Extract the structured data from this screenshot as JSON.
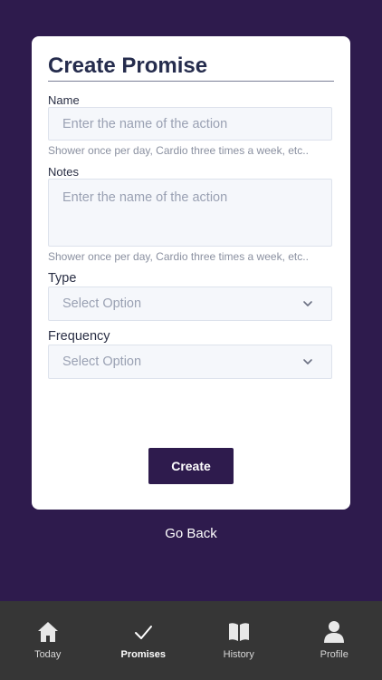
{
  "form": {
    "title": "Create Promise",
    "name_label": "Name",
    "name_placeholder": "Enter the name of the action",
    "name_hint": "Shower once per day, Cardio three times a week, etc..",
    "notes_label": "Notes",
    "notes_placeholder": "Enter the name of the action",
    "notes_hint": "Shower once per day, Cardio three times a week, etc..",
    "type_label": "Type",
    "type_value": "Select Option",
    "frequency_label": "Frequency",
    "frequency_value": "Select Option",
    "create_label": "Create"
  },
  "go_back_label": "Go Back",
  "tabs": [
    {
      "label": "Today",
      "icon": "home-icon",
      "active": false
    },
    {
      "label": "Promises",
      "icon": "checkmark-icon",
      "active": true
    },
    {
      "label": "History",
      "icon": "book-icon",
      "active": false
    },
    {
      "label": "Profile",
      "icon": "person-icon",
      "active": false
    }
  ],
  "colors": {
    "background": "#2e1b4d",
    "card": "#ffffff",
    "button": "#2e1b4d",
    "tabbar": "#363636"
  }
}
